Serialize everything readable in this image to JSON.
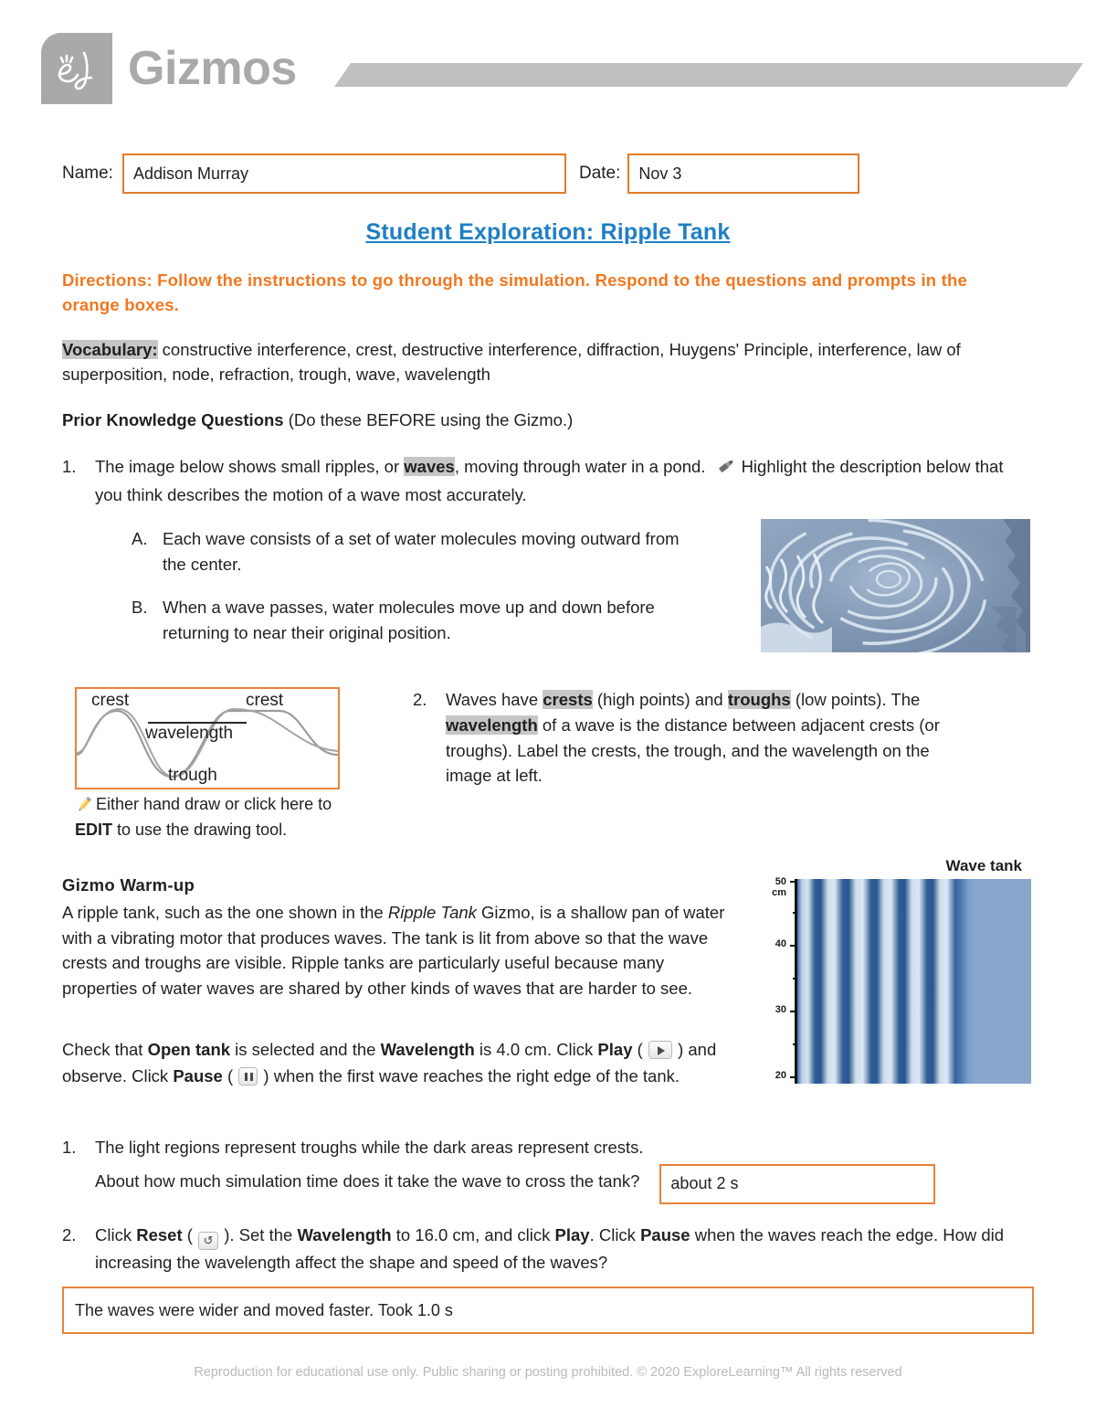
{
  "header": {
    "logo_text": "Gizmos",
    "logo_monogram": "el"
  },
  "meta": {
    "name_label": "Name:",
    "name_value": "Addison Murray",
    "date_label": "Date:",
    "date_value": "Nov 3"
  },
  "title": "Student Exploration: Ripple Tank",
  "directions": "Directions: Follow the instructions to go through the simulation. Respond to the questions and prompts in the orange boxes.",
  "vocabulary": {
    "label": "Vocabulary:",
    "terms": " constructive interference, crest, destructive interference, diffraction, Huygens' Principle, interference, law of superposition, node, refraction, trough, wave, wavelength"
  },
  "prior_knowledge": {
    "heading": "Prior Knowledge Questions",
    "note": " (Do these BEFORE using the Gizmo.)"
  },
  "q1": {
    "number": "1.",
    "text_a": "The image below shows small ripples, or ",
    "bold_term": "waves",
    "text_b": ", moving through water in a pond.",
    "text_c": "Highlight the description below that you think describes the motion of a wave most accurately.",
    "choices": [
      {
        "letter": "A.",
        "text": "Each wave consists of a set of water molecules moving outward from the center."
      },
      {
        "letter": "B.",
        "text": "When a wave passes, water molecules move up and down before returning to near their original position."
      }
    ]
  },
  "wave_diagram": {
    "crest_left": "crest",
    "crest_right": "crest",
    "wavelength": "wavelength",
    "trough": "trough",
    "edit_note_a": "Either hand draw or click here to ",
    "edit_note_bold": "EDIT",
    "edit_note_b": " to use the drawing tool."
  },
  "q2": {
    "number": "2.",
    "p1": "Waves have ",
    "t1": "crests",
    "p2": " (high points) and ",
    "t2": "troughs",
    "p3": " (low points). The ",
    "t3": "wavelength",
    "p4": " of a wave is the distance between adjacent crests (or troughs). Label the crests, the trough, and the wavelength on the image at left."
  },
  "warmup": {
    "heading": "Gizmo Warm-up",
    "p1": "A ripple tank, such as the one shown in the ",
    "italic": "Ripple Tank",
    "p2": " Gizmo, is a shallow pan of water with a vibrating motor that produces waves. The tank is lit from above so that the wave crests and troughs are visible. Ripple tanks are particularly useful because many properties of water waves are shared by other kinds of waves that are harder to see."
  },
  "check_para": {
    "s1": "Check that ",
    "b1": "Open tank",
    "s2": " is selected and the ",
    "b2": "Wavelength",
    "s3": " is 4.0 cm. Click ",
    "b3": "Play",
    "s4": " ( ",
    "s5": " ) and observe. Click ",
    "b4": "Pause",
    "s6": " ( ",
    "s7": " ) when the first wave reaches the right edge of the tank."
  },
  "tank_figure": {
    "title": "Wave tank",
    "axis_unit": "cm",
    "axis_labels": [
      "50",
      "40",
      "30",
      "20"
    ]
  },
  "q3": {
    "number": "1.",
    "text": "The light regions represent troughs while the dark areas represent crests.",
    "sub_question": "About how much simulation time does it take the wave to cross the tank?",
    "answer": "about 2 s"
  },
  "q4": {
    "number": "2.",
    "s1": "Click ",
    "b1": "Reset",
    "s2": " ( ",
    "s3": " ). Set the ",
    "b2": "Wavelength",
    "s4": " to 16.0 cm, and click ",
    "b3": "Play",
    "s5": ". Click ",
    "b4": "Pause",
    "s6": " when the waves reach the edge. How did increasing the wavelength affect the shape and speed of the waves?",
    "answer": "The waves were wider and moved faster. Took 1.0 s"
  },
  "footer": "Reproduction for educational use only. Public sharing or posting prohibited. © 2020 ExploreLearning™ All rights reserved",
  "colors": {
    "accent_orange": "#e8833a",
    "directions_orange": "#f07820",
    "title_blue": "#1f7fc4",
    "logo_gray": "#a9a9a9",
    "highlight_gray": "#c6c6c6"
  }
}
